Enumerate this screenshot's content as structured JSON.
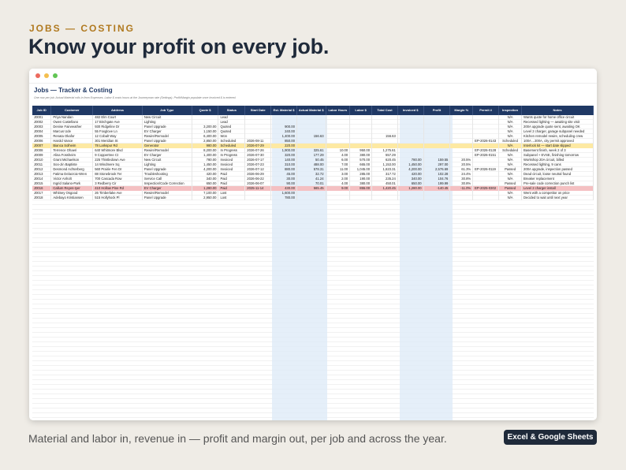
{
  "eyebrow": "JOBS — COSTING",
  "headline": "Know your profit on every job.",
  "sheet": {
    "title": "Jobs — Tracker & Costing",
    "note": "One row per job. Actual Material rolls in from Expenses. Labor $ costs hours at the Journeyman rate (Settings). Profit/Margin populate once Invoiced $ is entered.",
    "headers": [
      "Job ID",
      "Customer",
      "Address",
      "Job Type",
      "Quote $",
      "Status",
      "Start Date",
      "Est. Material $",
      "Actual Material $",
      "Labor Hours",
      "Labor $",
      "Total Cost",
      "Invoiced $",
      "Profit",
      "Margin %",
      "Permit #",
      "Inspection",
      "Notes"
    ],
    "rows": [
      {
        "cells": [
          "J0001",
          "Priya Nandan",
          "482 Elm Court",
          "New Circuit",
          "",
          "Lead",
          "",
          "",
          "",
          "",
          "",
          "",
          "",
          "",
          "",
          "",
          "N/A",
          "Wants quote for home office circuit"
        ]
      },
      {
        "cells": [
          "J0002",
          "Owen Castellano",
          "17 Birchgate Ave",
          "Lighting",
          "",
          "Lead",
          "",
          "",
          "",
          "",
          "",
          "",
          "",
          "",
          "",
          "",
          "N/A",
          "Recessed lighting — awaiting site visit"
        ]
      },
      {
        "cells": [
          "J0003",
          "Denise Fairweather",
          "930 Ridgeline Dr",
          "Panel Upgrade",
          "3,200.00",
          "Quoted",
          "",
          "900.00",
          "",
          "",
          "",
          "",
          "",
          "",
          "",
          "",
          "N/A",
          "200A upgrade quote sent, awaiting OK"
        ]
      },
      {
        "cells": [
          "J0004",
          "Marcus Ude",
          "55 Foxglove Ln",
          "EV Charger",
          "1,150.00",
          "Quoted",
          "",
          "240.00",
          "",
          "",
          "",
          "",
          "",
          "",
          "",
          "",
          "N/A",
          "Level 2 charger, garage subpanel needed"
        ]
      },
      {
        "cells": [
          "J0005",
          "Renata Okafor",
          "12 Cobalt Way",
          "Rewire/Remodel",
          "6,400.00",
          "Won",
          "",
          "1,400.00",
          "156.63",
          "",
          "",
          "156.63",
          "",
          "",
          "",
          "",
          "N/A",
          "Kitchen remodel rewire, scheduling crew"
        ]
      },
      {
        "cells": [
          "J0006",
          "Harold Vance",
          "301 Meridian St",
          "Panel Upgrade",
          "2,850.00",
          "Scheduled",
          "2026-08-11",
          "850.00",
          "",
          "",
          "",
          "",
          "",
          "",
          "",
          "EP-2026-0143",
          "Scheduled",
          "100A→200A, city permit approved"
        ]
      },
      {
        "cells": [
          "J0007",
          "Bianca Solheim",
          "78 Larkspur Rd",
          "Generator",
          "980.00",
          "Scheduled",
          "2026-07-29",
          "220.00",
          "",
          "",
          "",
          "",
          "",
          "",
          "",
          "",
          "N/A",
          "Interlock kit — start date slipped"
        ],
        "hl": "yellow"
      },
      {
        "cells": [
          "J0008",
          "Terrence Ohaeri",
          "640 Whitmore Blvd",
          "Rewire/Remodel",
          "8,200.00",
          "In Progress",
          "2026-07-26",
          "1,900.00",
          "325.61",
          "10.00",
          "950.00",
          "1,275.61",
          "",
          "",
          "",
          "EP-2026-0128",
          "Scheduled",
          "Basement finish, week 2 of 3"
        ]
      },
      {
        "cells": [
          "J0009",
          "Alina Fossheim",
          "9 Coppertree Ct",
          "EV Charger",
          "1,400.00",
          "In Progress",
          "2026-07-30",
          "320.00",
          "177.29",
          "4.00",
          "380.00",
          "557.29",
          "",
          "",
          "",
          "EP-2026-0151",
          "N/A",
          "Subpanel + EVSE, finishing tomorrow"
        ]
      },
      {
        "cells": [
          "J0010",
          "Grant Michaelson",
          "225 Thistledown Ave",
          "New Circuit",
          "780.00",
          "Invoiced",
          "2026-07-17",
          "140.00",
          "50.45",
          "6.00",
          "570.00",
          "620.45",
          "780.00",
          "159.55",
          "20.5%",
          "",
          "N/A",
          "Workshop 20A circuit, billed"
        ]
      },
      {
        "cells": [
          "J0011",
          "Soo-Jin Baptiste",
          "14 Windmere Sq",
          "Lighting",
          "1,450.00",
          "Invoiced",
          "2026-07-23",
          "310.00",
          "488.00",
          "7.00",
          "665.00",
          "1,153.00",
          "1,450.00",
          "297.00",
          "20.5%",
          "",
          "N/A",
          "Recessed lighting, 9 cans"
        ]
      },
      {
        "cells": [
          "J0012",
          "Desmond Achterberg",
          "560 Prairie Fen Dr",
          "Panel Upgrade",
          "4,200.00",
          "Invoiced",
          "2026-07-12",
          "880.00",
          "578.31",
          "11.00",
          "1,045.00",
          "1,623.31",
          "4,200.00",
          "2,576.69",
          "61.3%",
          "EP-2026-0119",
          "Passed",
          "200A upgrade, inspection passed"
        ]
      },
      {
        "cells": [
          "J0013",
          "Fatima Delacroix-Wren",
          "88 Stonebrook Ter",
          "Troubleshooting",
          "420.00",
          "Paid",
          "2026-06-29",
          "45.00",
          "32.72",
          "3.00",
          "285.00",
          "317.72",
          "420.00",
          "102.28",
          "24.4%",
          "",
          "N/A",
          "Dead circuit, loose neutral found"
        ]
      },
      {
        "cells": [
          "J0014",
          "Victor Anholt",
          "700 Cascada Row",
          "Service Call",
          "340.00",
          "Paid",
          "2026-06-22",
          "30.00",
          "41.24",
          "2.00",
          "190.00",
          "235.24",
          "340.00",
          "104.76",
          "30.8%",
          "",
          "N/A",
          "Breaker replacement"
        ]
      },
      {
        "cells": [
          "J0015",
          "Ingrid Salano-Park",
          "3 Redberry Cir",
          "Inspection/Code Correction",
          "650.00",
          "Paid",
          "2026-06-07",
          "90.00",
          "70.01",
          "4.00",
          "380.00",
          "450.01",
          "650.00",
          "199.99",
          "30.8%",
          "",
          "Passed",
          "Pre-sale code correction punch list"
        ]
      },
      {
        "cells": [
          "J0016",
          "Callum Reyes-Iyer",
          "410 Hollow Pine Rd",
          "EV Charger",
          "1,280.00",
          "Paid",
          "2025-11-14",
          "430.00",
          "565.45",
          "9.00",
          "855.00",
          "1,420.45",
          "1,280.00",
          "-140.45",
          "-11.0%",
          "EP-2025-0302",
          "Passed",
          "Level 2 charger install"
        ],
        "hl": "red"
      },
      {
        "cells": [
          "J0017",
          "Whitney Osgood",
          "26 Timberlake Ave",
          "Rewire/Remodel",
          "7,100.00",
          "Lost",
          "",
          "1,600.00",
          "",
          "",
          "",
          "",
          "",
          "",
          "",
          "",
          "N/A",
          "Went with a competitor on price"
        ]
      },
      {
        "cells": [
          "J0018",
          "Adebayo Kristiansen",
          "515 Hollyhock Pl",
          "Panel Upgrade",
          "2,950.00",
          "Lost",
          "",
          "780.00",
          "",
          "",
          "",
          "",
          "",
          "",
          "",
          "",
          "N/A",
          "Decided to wait until next year"
        ]
      }
    ]
  },
  "tagline": "Material and labor in, revenue in — profit and margin out, per job and across the year.",
  "badge": "Excel & Google Sheets",
  "colors": {
    "accent": "#b0791f",
    "header": "#1f3864",
    "highlight_yellow": "#fde9a3",
    "highlight_red": "#f4c0c2",
    "calc_column": "#deebf7"
  }
}
